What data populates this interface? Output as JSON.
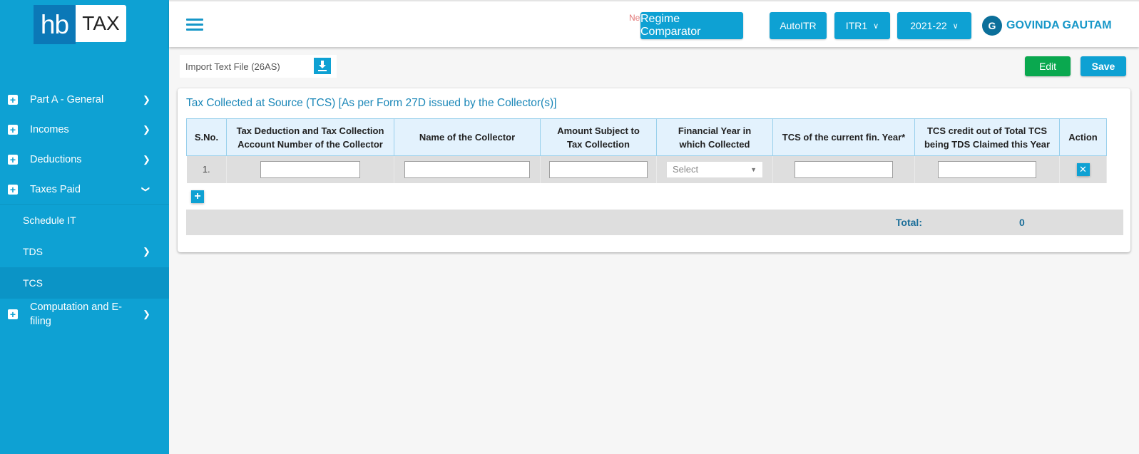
{
  "logo": {
    "left": "hb",
    "right": "TAX"
  },
  "sidebar": {
    "items": [
      {
        "label": "Part A - General",
        "state": "collapsed"
      },
      {
        "label": "Incomes",
        "state": "collapsed"
      },
      {
        "label": "Deductions",
        "state": "collapsed"
      },
      {
        "label": "Taxes Paid",
        "state": "expanded"
      }
    ],
    "subitems": [
      {
        "label": "Schedule IT"
      },
      {
        "label": "TDS"
      },
      {
        "label": "TCS",
        "active": true
      }
    ],
    "last_item": {
      "label_line1": "Computation and E-",
      "label_line2": "filing"
    }
  },
  "header": {
    "new_badge": "New",
    "regime_button": "Regime Comparator",
    "autoitr_button": "AutoITR",
    "itr_select": "ITR1",
    "year_select": "2021-22",
    "user_initial": "G",
    "user_name": "GOVINDA GAUTAM"
  },
  "toolbar": {
    "import_label": "Import Text File (26AS)",
    "edit_label": "Edit",
    "save_label": "Save"
  },
  "card": {
    "title": "Tax Collected at Source (TCS) [As per Form 27D issued by the Collector(s)]",
    "columns": [
      {
        "line1": "S.No.",
        "line2": ""
      },
      {
        "line1": "Tax Deduction and Tax Collection",
        "line2": "Account Number of the Collector"
      },
      {
        "line1": "Name of the Collector",
        "line2": ""
      },
      {
        "line1": "Amount Subject to",
        "line2": "Tax Collection"
      },
      {
        "line1": "Financial Year in",
        "line2": "which Collected"
      },
      {
        "line1": "TCS of the current fin. Year*",
        "line2": ""
      },
      {
        "line1": "TCS credit out of Total TCS",
        "line2": "being TDS Claimed this Year"
      },
      {
        "line1": "Action",
        "line2": ""
      }
    ],
    "rows": [
      {
        "sno": "1.",
        "tan": "",
        "name": "",
        "amount": "",
        "fy": "Select",
        "tcs": "",
        "credit": ""
      }
    ],
    "total_label": "Total:",
    "total_value": "0"
  }
}
